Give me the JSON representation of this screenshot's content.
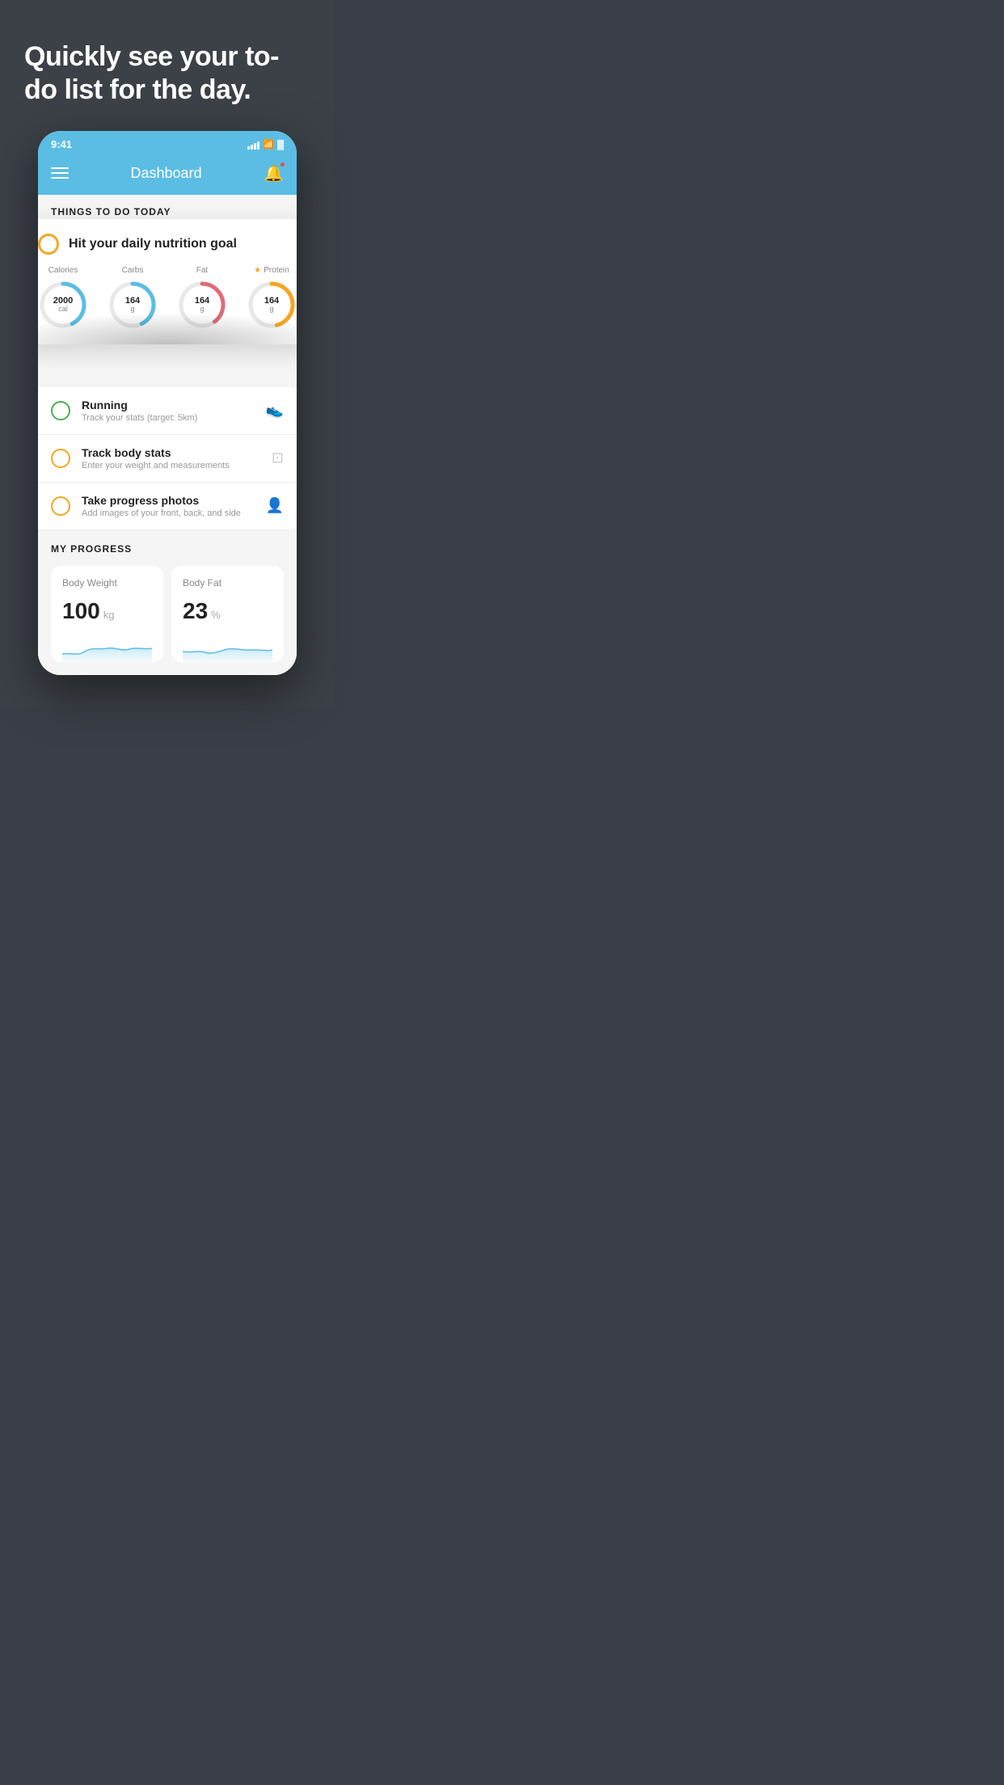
{
  "hero": {
    "title": "Quickly see your to-do list for the day."
  },
  "statusBar": {
    "time": "9:41",
    "signal": "signal",
    "wifi": "wifi",
    "battery": "battery"
  },
  "header": {
    "title": "Dashboard",
    "menu_label": "menu",
    "bell_label": "notifications"
  },
  "thingsToDo": {
    "section_title": "THINGS TO DO TODAY",
    "nutritionCard": {
      "circle_label": "incomplete",
      "title": "Hit your daily nutrition goal",
      "goals": [
        {
          "label": "Calories",
          "value": "2000",
          "unit": "cal",
          "color": "blue",
          "starred": false
        },
        {
          "label": "Carbs",
          "value": "164",
          "unit": "g",
          "color": "blue",
          "starred": false
        },
        {
          "label": "Fat",
          "value": "164",
          "unit": "g",
          "color": "red",
          "starred": false
        },
        {
          "label": "Protein",
          "value": "164",
          "unit": "g",
          "color": "yellow",
          "starred": true
        }
      ]
    },
    "items": [
      {
        "title": "Running",
        "subtitle": "Track your stats (target: 5km)",
        "circle_color": "green",
        "icon": "shoe"
      },
      {
        "title": "Track body stats",
        "subtitle": "Enter your weight and measurements",
        "circle_color": "yellow",
        "icon": "scale"
      },
      {
        "title": "Take progress photos",
        "subtitle": "Add images of your front, back, and side",
        "circle_color": "yellow",
        "icon": "person"
      }
    ]
  },
  "myProgress": {
    "section_title": "MY PROGRESS",
    "cards": [
      {
        "title": "Body Weight",
        "value": "100",
        "unit": "kg"
      },
      {
        "title": "Body Fat",
        "value": "23",
        "unit": "%"
      }
    ]
  }
}
